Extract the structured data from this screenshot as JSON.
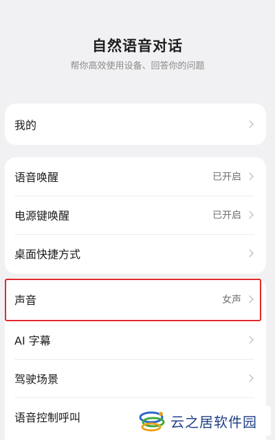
{
  "header": {
    "title": "自然语音对话",
    "subtitle": "帮你高效使用设备、回答你的问题"
  },
  "sections": [
    {
      "items": [
        {
          "label": "我的",
          "value": ""
        }
      ]
    },
    {
      "items": [
        {
          "label": "语音唤醒",
          "value": "已开启"
        },
        {
          "label": "电源键唤醒",
          "value": "已开启"
        },
        {
          "label": "桌面快捷方式",
          "value": ""
        }
      ]
    },
    {
      "items": [
        {
          "label": "声音",
          "value": "女声"
        },
        {
          "label": "AI 字幕",
          "value": ""
        },
        {
          "label": "驾驶场景",
          "value": ""
        },
        {
          "label": "语音控制呼叫",
          "value": ""
        }
      ]
    }
  ],
  "highlight_color": "#e0282a",
  "watermark": {
    "text": "云之居软件园"
  }
}
